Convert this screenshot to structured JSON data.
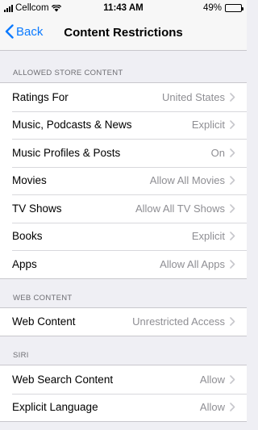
{
  "status_bar": {
    "carrier": "Cellcom",
    "time": "11:43 AM",
    "battery_percent": "49%",
    "battery_level": 0.49
  },
  "nav": {
    "back_label": "Back",
    "title": "Content Restrictions"
  },
  "sections": [
    {
      "header": "ALLOWED STORE CONTENT",
      "rows": [
        {
          "label": "Ratings For",
          "value": "United States"
        },
        {
          "label": "Music, Podcasts & News",
          "value": "Explicit"
        },
        {
          "label": "Music Profiles & Posts",
          "value": "On"
        },
        {
          "label": "Movies",
          "value": "Allow All Movies"
        },
        {
          "label": "TV Shows",
          "value": "Allow All TV Shows"
        },
        {
          "label": "Books",
          "value": "Explicit"
        },
        {
          "label": "Apps",
          "value": "Allow All Apps"
        }
      ]
    },
    {
      "header": "WEB CONTENT",
      "rows": [
        {
          "label": "Web Content",
          "value": "Unrestricted Access"
        }
      ]
    },
    {
      "header": "SIRI",
      "rows": [
        {
          "label": "Web Search Content",
          "value": "Allow"
        },
        {
          "label": "Explicit Language",
          "value": "Allow"
        }
      ]
    }
  ],
  "colors": {
    "accent": "#0a7aff",
    "background": "#efeff4",
    "secondary_text": "#8e8e93"
  },
  "icons": [
    "signal-bars-icon",
    "wifi-icon",
    "battery-icon",
    "back-chevron-icon",
    "disclosure-chevron-icon"
  ]
}
